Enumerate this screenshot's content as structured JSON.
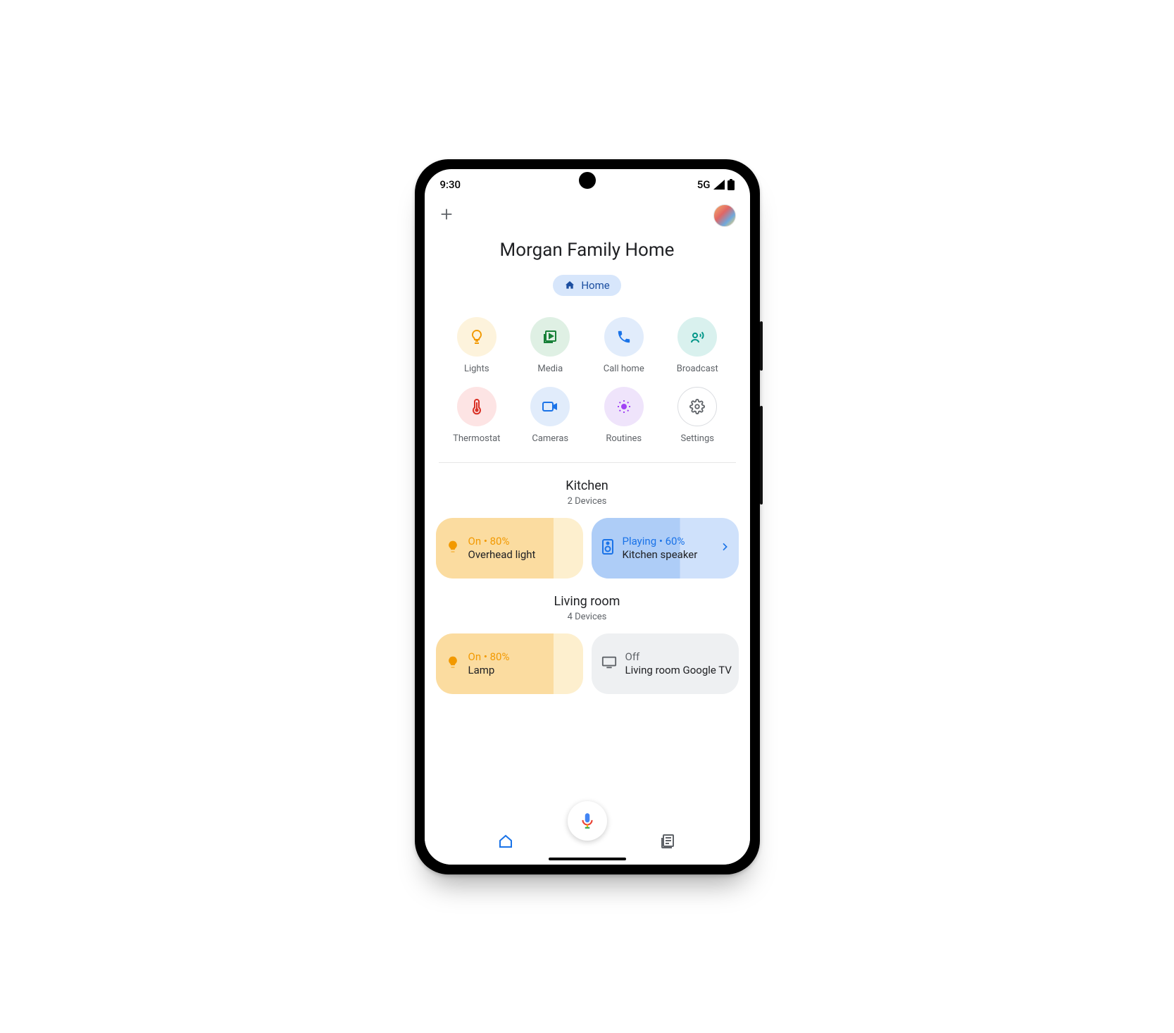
{
  "status": {
    "time": "9:30",
    "network": "5G"
  },
  "header": {
    "title": "Morgan Family Home",
    "chip_label": "Home"
  },
  "actions": [
    {
      "key": "lights",
      "label": "Lights",
      "bg": "#fdf3dc",
      "fg": "#f29900"
    },
    {
      "key": "media",
      "label": "Media",
      "bg": "#dff0e4",
      "fg": "#188038"
    },
    {
      "key": "call-home",
      "label": "Call home",
      "bg": "#e1ecfb",
      "fg": "#1a73e8"
    },
    {
      "key": "broadcast",
      "label": "Broadcast",
      "bg": "#d9f1ee",
      "fg": "#009688"
    },
    {
      "key": "thermostat",
      "label": "Thermostat",
      "bg": "#fde4e4",
      "fg": "#d93025"
    },
    {
      "key": "cameras",
      "label": "Cameras",
      "bg": "#e1ecfb",
      "fg": "#1a73e8"
    },
    {
      "key": "routines",
      "label": "Routines",
      "bg": "#efe4fb",
      "fg": "#a142f4"
    },
    {
      "key": "settings",
      "label": "Settings",
      "bg": "#ffffff",
      "fg": "#5f6368"
    }
  ],
  "rooms": [
    {
      "name": "Kitchen",
      "count_label": "2 Devices",
      "devices": [
        {
          "key": "overhead-light",
          "kind": "light",
          "status": "On • 80%",
          "name": "Overhead light",
          "percent": 80,
          "colors": {
            "bg": "#fdefce",
            "fill": "#fbdca0",
            "accent": "#f29900"
          }
        },
        {
          "key": "kitchen-speaker",
          "kind": "speaker",
          "status": "Playing • 60%",
          "name": "Kitchen speaker",
          "percent": 60,
          "chevron": true,
          "colors": {
            "bg": "#cfe1fb",
            "fill": "#aecdf7",
            "accent": "#1a73e8"
          }
        }
      ]
    },
    {
      "name": "Living room",
      "count_label": "4 Devices",
      "devices": [
        {
          "key": "lamp",
          "kind": "light",
          "status": "On • 80%",
          "name": "Lamp",
          "percent": 80,
          "colors": {
            "bg": "#fdefce",
            "fill": "#fbdca0",
            "accent": "#f29900"
          }
        },
        {
          "key": "living-room-tv",
          "kind": "tv",
          "status": "Off",
          "name": "Living room Google TV",
          "percent": 0,
          "colors": {
            "bg": "#eef0f2",
            "fill": "#eef0f2",
            "accent": "#5f6368"
          }
        }
      ]
    }
  ]
}
